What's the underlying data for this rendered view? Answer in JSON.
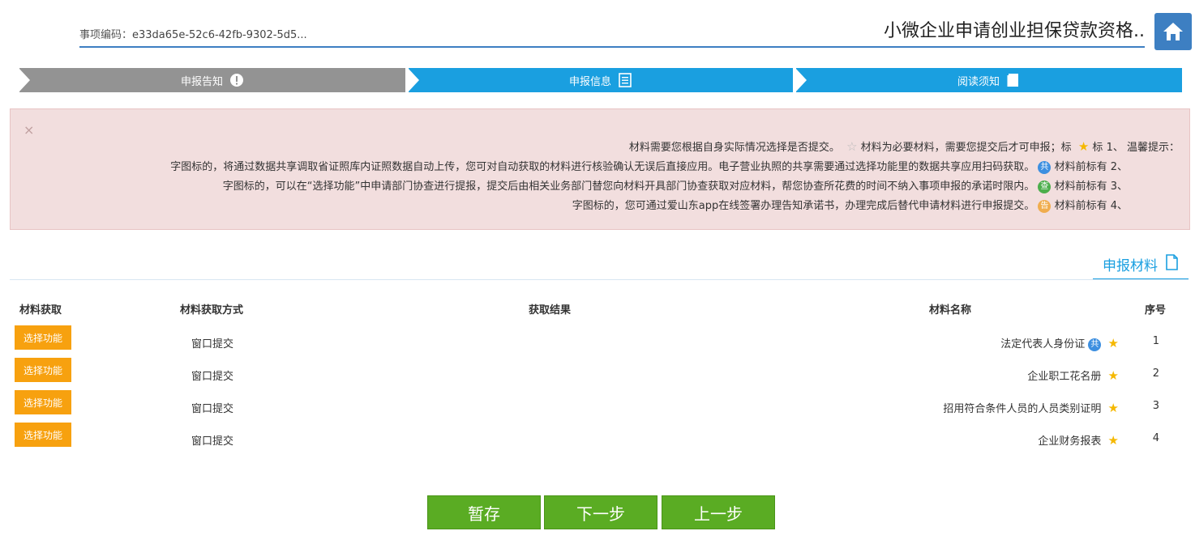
{
  "header": {
    "title": "小微企业申请创业担保贷款资格..",
    "code_label": "事项编码：",
    "code_value": "e33da65e-52c6-42fb-9302-5d5..."
  },
  "steps": [
    {
      "label": "阅读须知",
      "state": "active",
      "icon": "book-icon"
    },
    {
      "label": "申报信息",
      "state": "active",
      "icon": "form-list-icon"
    },
    {
      "label": "申报告知",
      "state": "inactive",
      "icon": "exclamation-icon"
    }
  ],
  "notice": {
    "close_symbol": "×",
    "prefix": "温馨提示：",
    "lines": [
      {
        "num": "1、",
        "text_a": "标",
        "text_b": "材料为必要材料，需要您提交后才可申报；标",
        "text_c": "材料需要您根据自身实际情况选择是否提交。"
      },
      {
        "num": "2、",
        "text_a": "材料前标有",
        "badge": "共",
        "text_b": "字图标的，将通过数据共享调取省证照库内证照数据自动上传，您可对自动获取的材料进行核验确认无误后直接应用。电子营业执照的共享需要通过选择功能里的数据共享应用扫码获取。"
      },
      {
        "num": "3、",
        "text_a": "材料前标有",
        "badge": "查",
        "text_b": "字图标的，可以在“选择功能”中申请部门协查进行提报，提交后由相关业务部门替您向材料开具部门协查获取对应材料，帮您协查所花费的时间不纳入事项申报的承诺时限内。"
      },
      {
        "num": "4、",
        "text_a": "材料前标有",
        "badge": "告",
        "text_b": "字图标的，您可通过爱山东app在线签署办理告知承诺书，办理完成后替代申请材料进行申报提交。"
      }
    ]
  },
  "section": {
    "title": "申报材料"
  },
  "table": {
    "headers": {
      "idx": "序号",
      "name": "材料名称",
      "result": "获取结果",
      "method": "材料获取方式",
      "get": "材料获取"
    },
    "rows": [
      {
        "idx": "1",
        "name": "法定代表人身份证",
        "badge": "共",
        "method": "窗口提交",
        "button": "选择功能"
      },
      {
        "idx": "2",
        "name": "企业职工花名册",
        "badge": "",
        "method": "窗口提交",
        "button": "选择功能"
      },
      {
        "idx": "3",
        "name": "招用符合条件人员的人员类别证明",
        "badge": "",
        "method": "窗口提交",
        "button": "选择功能"
      },
      {
        "idx": "4",
        "name": "企业财务报表",
        "badge": "",
        "method": "窗口提交",
        "button": "选择功能"
      }
    ]
  },
  "buttons": {
    "prev": "上一步",
    "next": "下一步",
    "save": "暂存"
  },
  "colors": {
    "primary": "#1a9fe0",
    "home": "#3d7fc2",
    "green": "#5aac23",
    "orange": "#f7a10f",
    "notice_bg": "#f2dede",
    "inactive_step": "#939393"
  }
}
